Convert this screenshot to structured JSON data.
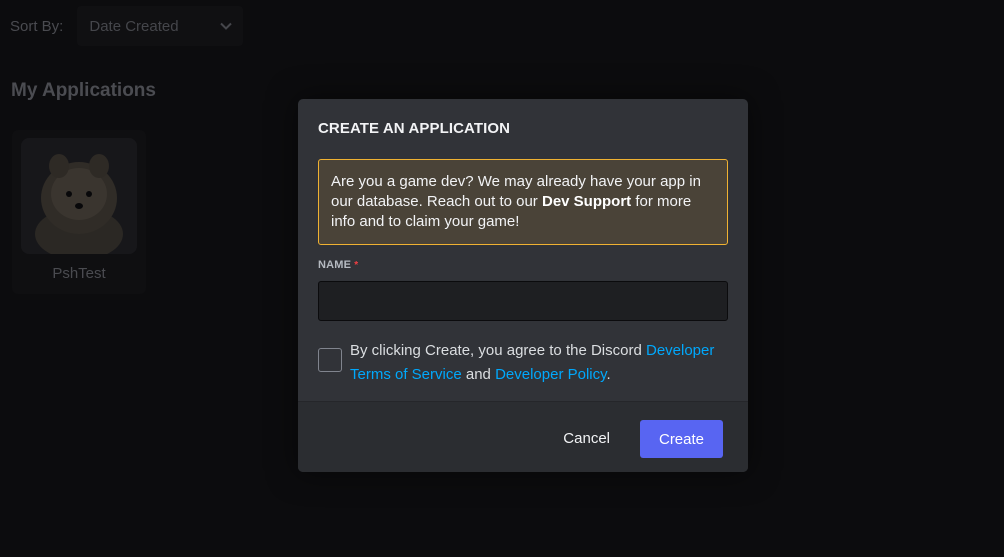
{
  "background": {
    "sort_label": "Sort By:",
    "sort_value": "Date Created",
    "section_title": "My Applications",
    "apps": [
      {
        "name": "PshTest"
      }
    ]
  },
  "modal": {
    "title": "CREATE AN APPLICATION",
    "notice": {
      "before": "Are you a game dev? We may already have your app in our database. Reach out to our ",
      "bold": "Dev Support",
      "after": " for more info and to claim your game!"
    },
    "name_label": "NAME",
    "required_mark": "*",
    "name_value": "",
    "agree": {
      "text_before": "By clicking Create, you agree to the Discord ",
      "link_tos": "Developer Terms of Service",
      "text_mid": " and ",
      "link_policy": "Developer Policy",
      "text_after": "."
    },
    "cancel_label": "Cancel",
    "create_label": "Create"
  },
  "colors": {
    "accent": "#5865f2",
    "link": "#00a8fc",
    "warning_border": "#f0b232",
    "required": "#f23f43"
  }
}
